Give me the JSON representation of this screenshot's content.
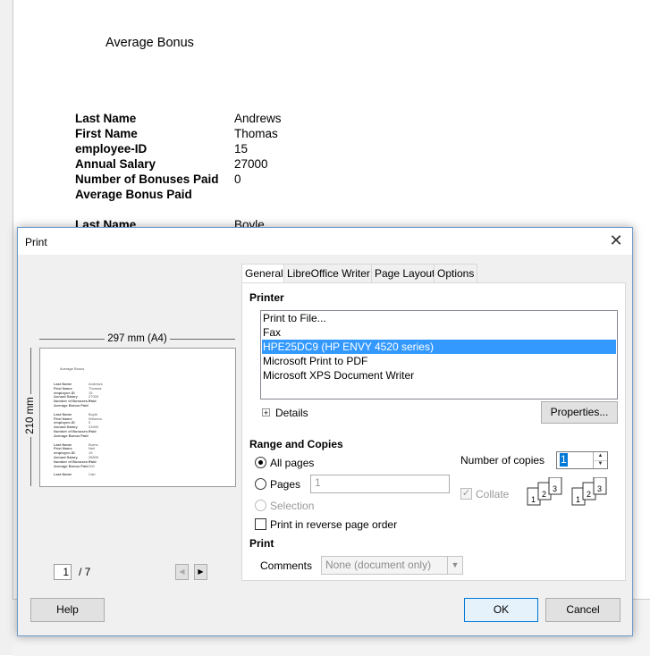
{
  "document": {
    "title": "Average Bonus",
    "record1": [
      {
        "key": "Last Name",
        "value": "Andrews"
      },
      {
        "key": "First Name",
        "value": "Thomas"
      },
      {
        "key": "employee-ID",
        "value": "15"
      },
      {
        "key": "Annual Salary",
        "value": "27000"
      },
      {
        "key": "Number of Bonuses Paid",
        "value": "0"
      },
      {
        "key": "Average Bonus Paid",
        "value": ""
      }
    ],
    "record2_partial": {
      "key": "Last Name",
      "value": "Boyle"
    }
  },
  "dialog": {
    "title": "Print",
    "close_glyph": "✕",
    "preview": {
      "width_label": "297 mm (A4)",
      "height_label": "210 mm",
      "current_page": "1",
      "total_pages": "/ 7",
      "prev_glyph": "◀",
      "next_glyph": "▶",
      "mini": {
        "title": "Average Bonus",
        "records": [
          {
            "rows": [
              [
                "Last Name",
                "Andrews"
              ],
              [
                "First Name",
                "Thomas"
              ],
              [
                "employee-ID",
                "15"
              ],
              [
                "Annual Salary",
                "27000"
              ],
              [
                "Number of Bonuses Paid",
                "0"
              ],
              [
                "Average Bonus Paid",
                ""
              ]
            ]
          },
          {
            "rows": [
              [
                "Last Name",
                "Boyle"
              ],
              [
                "First Name",
                "Winema"
              ],
              [
                "employee-ID",
                "5"
              ],
              [
                "Annual Salary",
                "23400"
              ],
              [
                "Number of Bonuses Paid",
                "2"
              ],
              [
                "Average Bonus Paid",
                ""
              ]
            ]
          },
          {
            "rows": [
              [
                "Last Name",
                "Burns"
              ],
              [
                "First Name",
                "Neil"
              ],
              [
                "employee-ID",
                "19"
              ],
              [
                "Annual Salary",
                "28500"
              ],
              [
                "Number of Bonuses Paid",
                "1"
              ],
              [
                "Average Bonus Paid",
                "100"
              ]
            ]
          },
          {
            "rows": [
              [
                "Last Name",
                "Carr"
              ]
            ]
          }
        ]
      }
    },
    "tabs": [
      "General",
      "LibreOffice Writer",
      "Page Layout",
      "Options"
    ],
    "printer": {
      "section_label": "Printer",
      "items": [
        "Print to File...",
        "Fax",
        "HPE25DC9 (HP ENVY 4520 series)",
        "Microsoft Print to PDF",
        "Microsoft XPS Document Writer"
      ],
      "selected_index": 2,
      "details_label": "Details",
      "expander_glyph": "+",
      "properties_label": "Properties..."
    },
    "range": {
      "section_label": "Range and Copies",
      "all_pages_label": "All pages",
      "pages_label": "Pages",
      "pages_value": "1",
      "selection_label": "Selection",
      "reverse_label": "Print in reverse page order",
      "copies_label": "Number of copies",
      "copies_value": "1",
      "collate_label": "Collate",
      "check_glyph": "✓",
      "spin_up_glyph": "▲",
      "spin_down_glyph": "▼"
    },
    "print_section": {
      "section_label": "Print",
      "comments_label": "Comments",
      "comments_value": "None (document only)",
      "dropdown_glyph": "▼"
    },
    "buttons": {
      "help": "Help",
      "ok": "OK",
      "cancel": "Cancel"
    },
    "collate_icon_numbers": [
      "1",
      "2",
      "3"
    ]
  }
}
